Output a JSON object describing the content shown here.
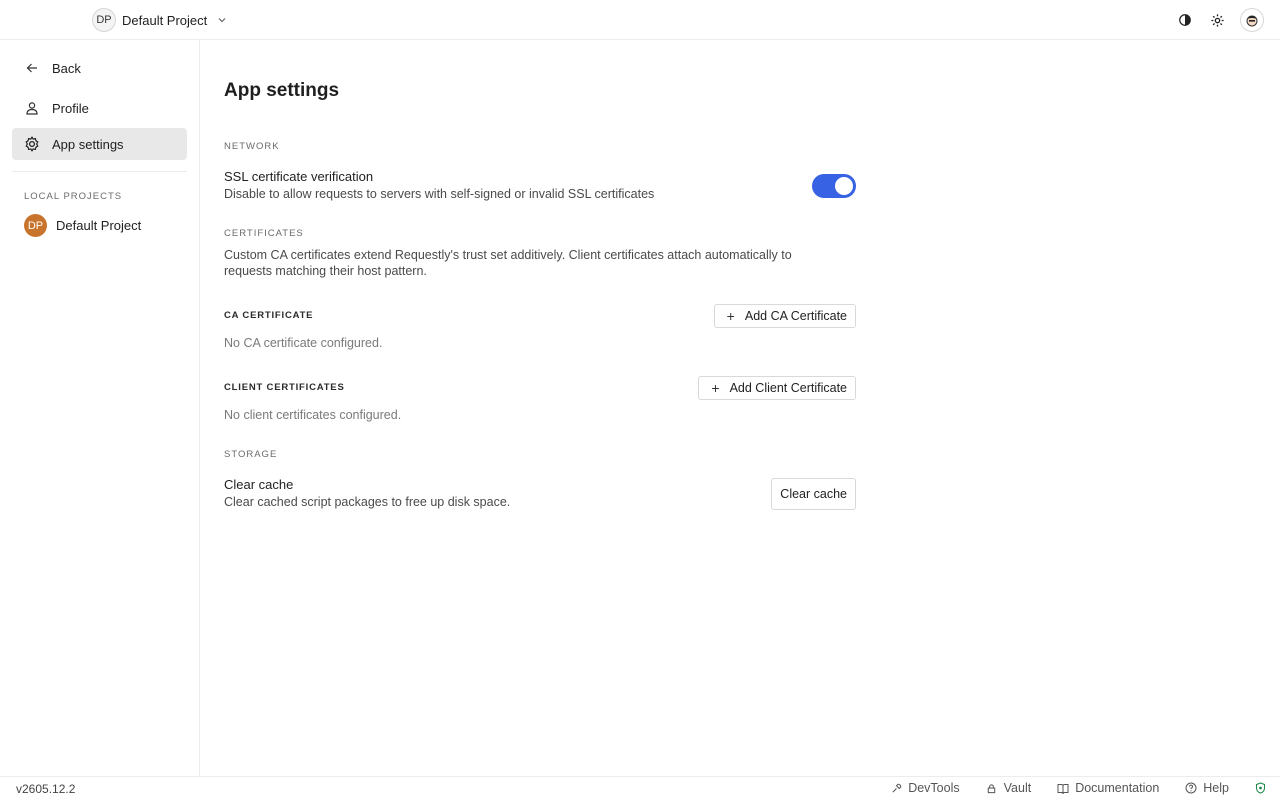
{
  "topbar": {
    "project_initials": "DP",
    "project_name": "Default Project"
  },
  "sidebar": {
    "back_label": "Back",
    "items": [
      {
        "label": "Profile",
        "icon": "user-icon"
      },
      {
        "label": "App settings",
        "icon": "gear-icon",
        "active": true
      }
    ],
    "local_projects_label": "LOCAL PROJECTS",
    "local_projects": [
      {
        "initials": "DP",
        "name": "Default Project",
        "color": "#c9742c"
      }
    ]
  },
  "main": {
    "title": "App settings",
    "network": {
      "label": "NETWORK",
      "ssl_title": "SSL certificate verification",
      "ssl_desc": "Disable to allow requests to servers with self-signed or invalid SSL certificates",
      "ssl_enabled": true
    },
    "certificates": {
      "label": "CERTIFICATES",
      "desc_line1": "Custom CA certificates extend Requestly's trust set additively. Client certificates attach automatically to",
      "desc_line2": "requests matching their host pattern.",
      "ca_label": "CA CERTIFICATE",
      "ca_button": "Add CA Certificate",
      "ca_empty": "No CA certificate configured.",
      "client_label": "CLIENT CERTIFICATES",
      "client_button": "Add Client Certificate",
      "client_empty": "No client certificates configured."
    },
    "storage": {
      "label": "STORAGE",
      "cache_title": "Clear cache",
      "cache_desc": "Clear cached script packages to free up disk space.",
      "cache_button": "Clear cache"
    }
  },
  "footer": {
    "version": "v2605.12.2",
    "links": [
      "DevTools",
      "Vault",
      "Documentation",
      "Help"
    ]
  },
  "colors": {
    "accent": "#3662e3",
    "project_avatar": "#c9742c",
    "active_nav": "#e8e8e8"
  }
}
